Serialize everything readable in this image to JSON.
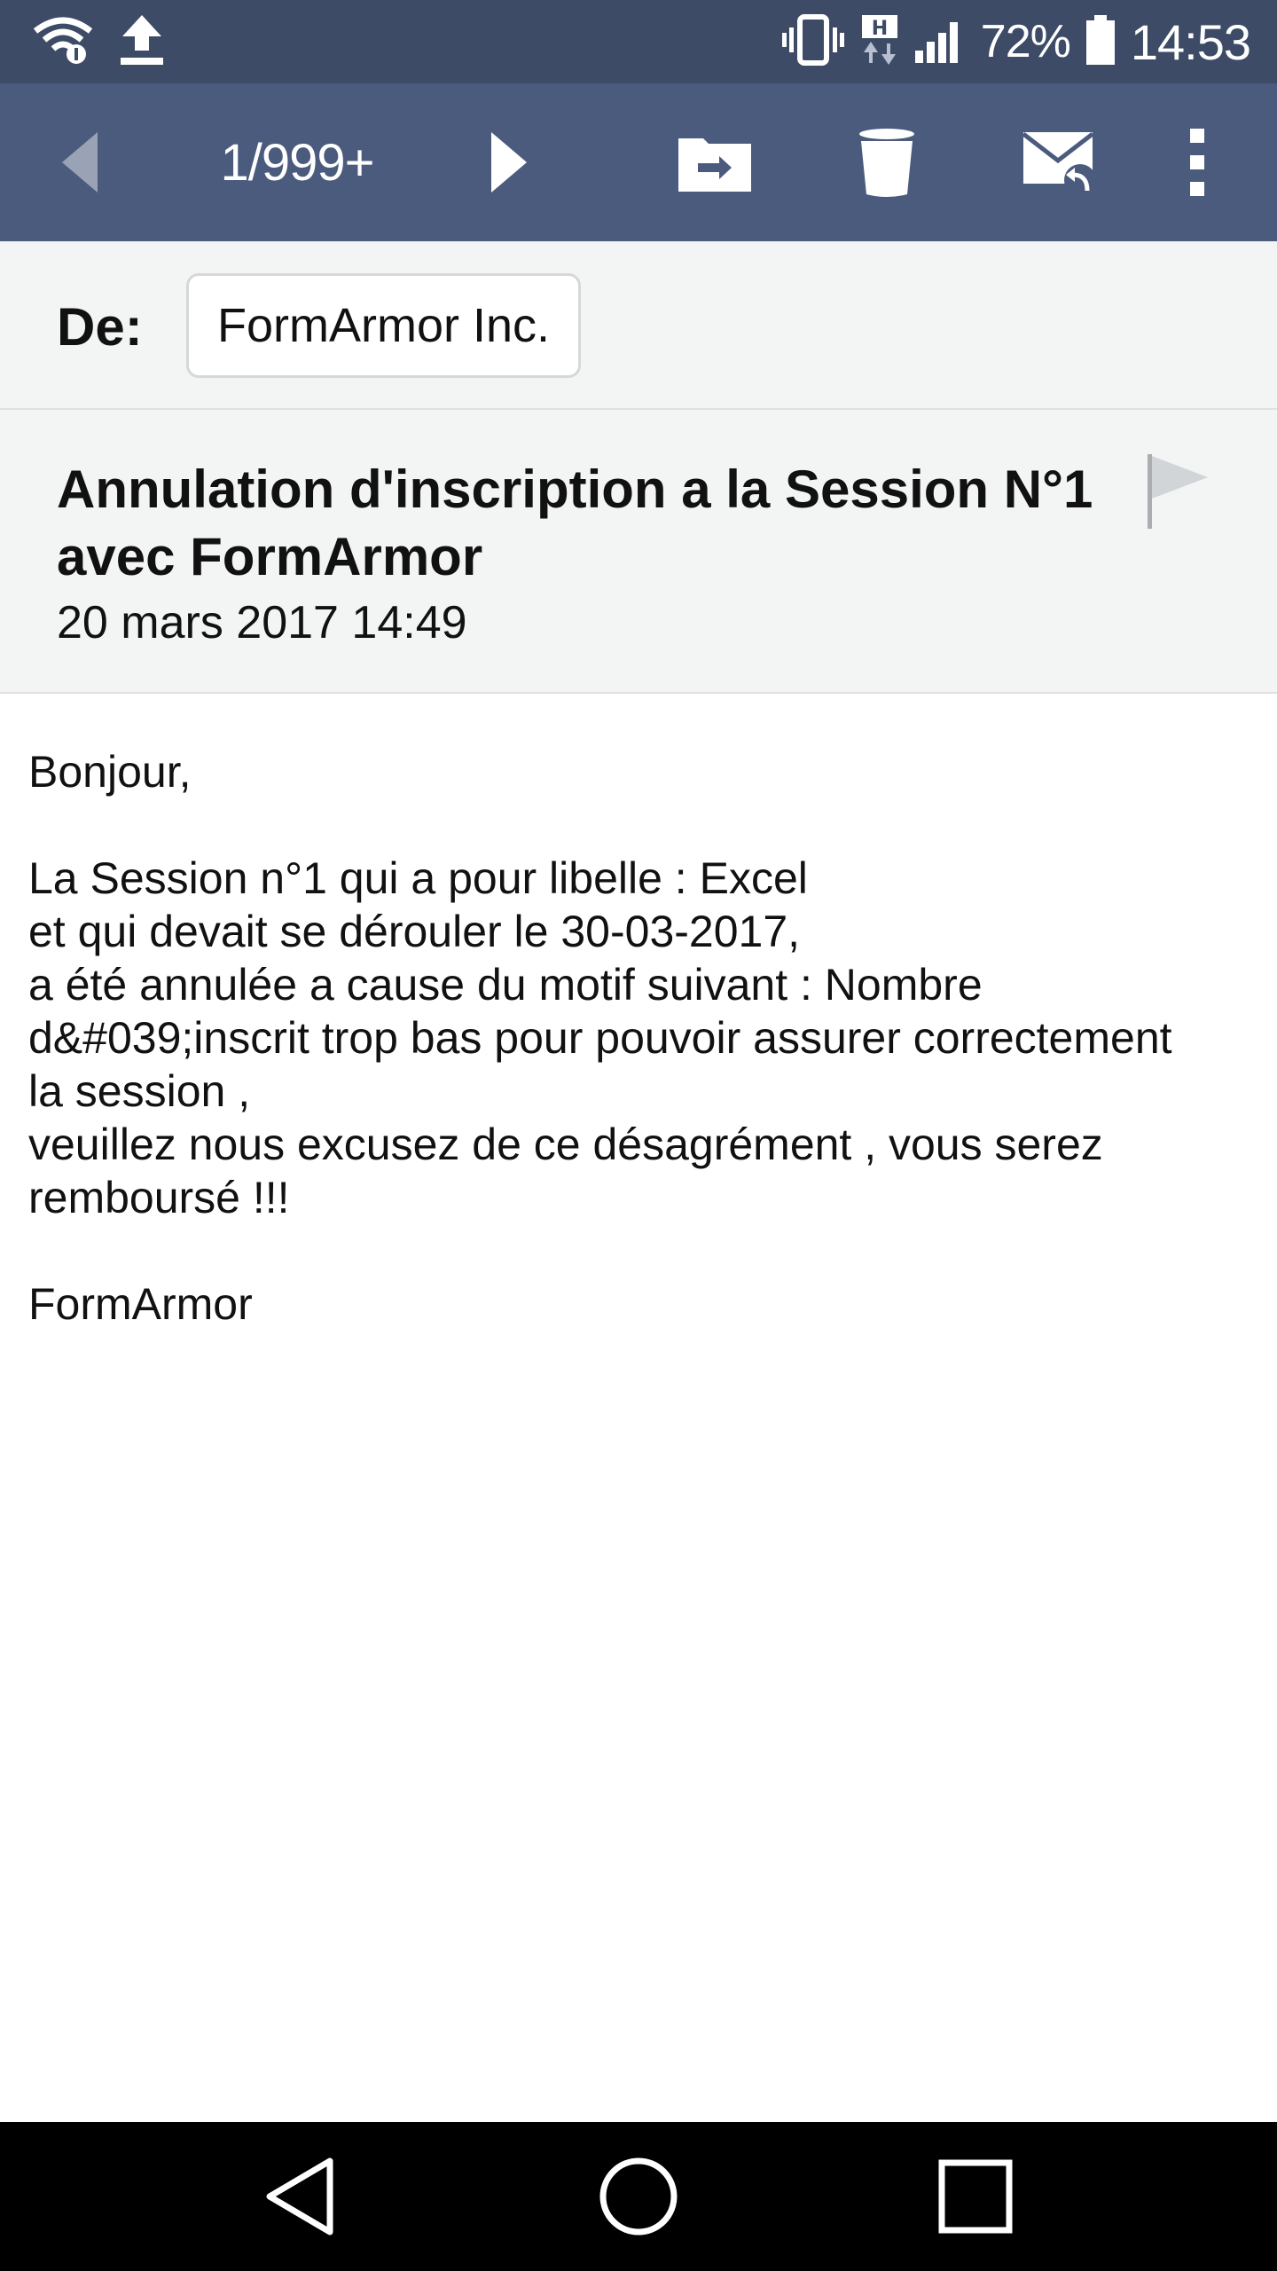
{
  "status_bar": {
    "battery_percent": "72%",
    "time": "14:53",
    "icons": [
      "wifi-icon",
      "upload-icon",
      "vibrate-icon",
      "hspa-icon",
      "signal-icon",
      "battery-icon"
    ]
  },
  "toolbar": {
    "counter": "1/999+",
    "icons": [
      "prev-icon",
      "next-icon",
      "move-folder-icon",
      "trash-icon",
      "reply-mail-icon",
      "more-icon"
    ]
  },
  "email": {
    "from_label": "De:",
    "sender": "FormArmor Inc.",
    "subject": "Annulation d'inscription a la Session N°1 avec FormArmor",
    "date": "20 mars 2017 14:49",
    "body_lines": [
      "Bonjour,",
      "",
      "La Session n°1 qui a pour libelle : Excel",
      "et qui devait se dérouler le 30-03-2017,",
      "a été annulée a cause du motif suivant : Nombre",
      "d&#039;inscrit trop bas pour pouvoir assurer correctement",
      "la session ,",
      "veuillez nous excusez de ce désagrément , vous serez",
      "remboursé !!!",
      "",
      "FormArmor"
    ]
  },
  "colors": {
    "status_bar": "#3d4b66",
    "toolbar": "#4b5b7e",
    "header_bg": "#f3f4f4",
    "nav_bar": "#000000"
  }
}
